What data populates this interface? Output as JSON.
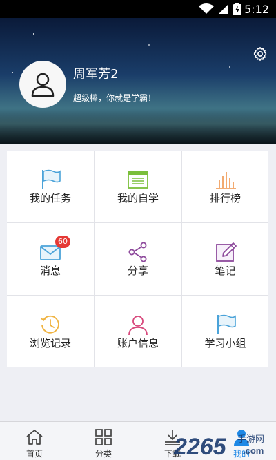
{
  "status_bar": {
    "time": "5:12"
  },
  "profile": {
    "name": "周军芳2",
    "motto": "超级棒，你就是学霸！"
  },
  "grid": {
    "items": [
      {
        "label": "我的任务",
        "icon": "flag-icon",
        "color": "#4ba3d9"
      },
      {
        "label": "我的自学",
        "icon": "window-list-icon",
        "color": "#7bbf3b"
      },
      {
        "label": "排行榜",
        "icon": "bar-chart-icon",
        "color": "#f0a060"
      },
      {
        "label": "消息",
        "icon": "envelope-icon",
        "color": "#4ba3d9",
        "badge": "60"
      },
      {
        "label": "分享",
        "icon": "share-icon",
        "color": "#8e4a9c"
      },
      {
        "label": "笔记",
        "icon": "pen-note-icon",
        "color": "#8e4a9c"
      },
      {
        "label": "浏览记录",
        "icon": "history-clock-icon",
        "color": "#f0b340"
      },
      {
        "label": "账户信息",
        "icon": "user-outline-icon",
        "color": "#d8487c"
      },
      {
        "label": "学习小组",
        "icon": "flag-icon",
        "color": "#4ba3d9"
      }
    ]
  },
  "tabbar": {
    "tabs": [
      {
        "label": "首页",
        "icon": "home-icon"
      },
      {
        "label": "分类",
        "icon": "grid-icon"
      },
      {
        "label": "下载",
        "icon": "download-icon"
      },
      {
        "label": "我的",
        "icon": "user-icon",
        "active": true
      }
    ]
  },
  "watermark": {
    "text": "2265",
    "site": "手游网",
    "domain": ".com"
  },
  "colors": {
    "accent": "#1e88e5",
    "badge": "#e53935"
  }
}
